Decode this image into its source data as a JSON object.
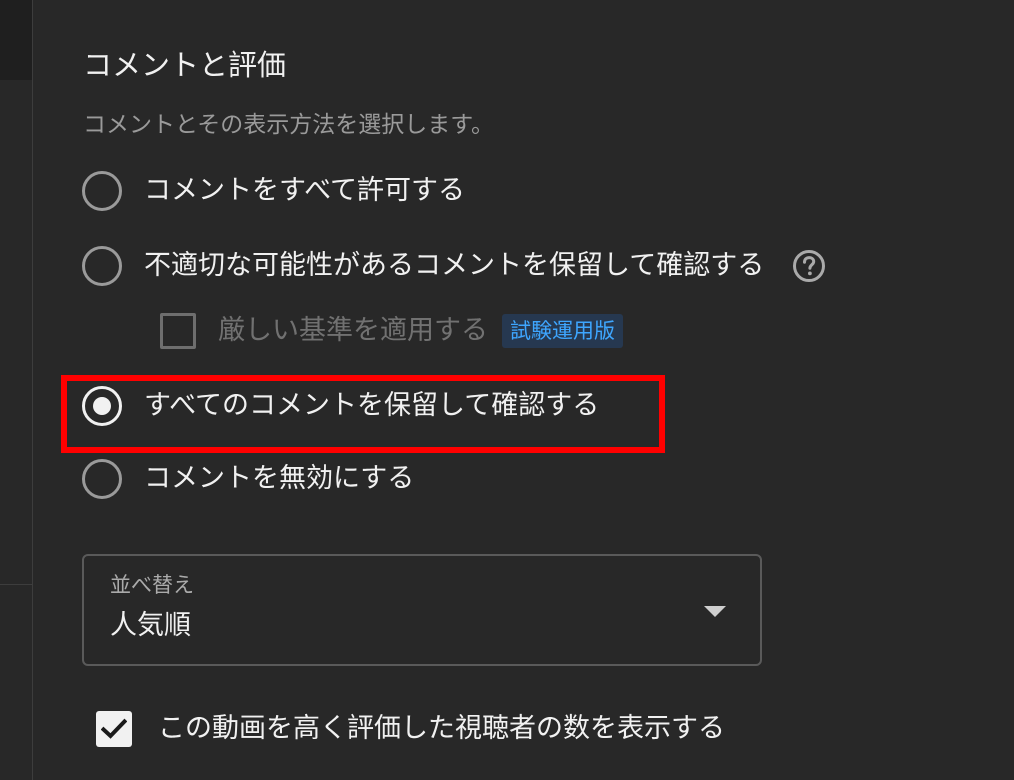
{
  "section": {
    "title": "コメントと評価",
    "description": "コメントとその表示方法を選択します。"
  },
  "comment_options": [
    {
      "label": "コメントをすべて許可する",
      "selected": false
    },
    {
      "label": "不適切な可能性があるコメントを保留して確認する",
      "selected": false,
      "has_help": true
    },
    {
      "label": "すべてのコメントを保留して確認する",
      "selected": true
    },
    {
      "label": "コメントを無効にする",
      "selected": false
    }
  ],
  "strict_filter": {
    "label": "厳しい基準を適用する",
    "badge": "試験運用版",
    "checked": false,
    "disabled": true
  },
  "sort": {
    "caption": "並べ替え",
    "value": "人気順"
  },
  "show_likes": {
    "label": "この動画を高く評価した視聴者の数を表示する",
    "checked": true
  },
  "icons": {
    "help": "help-circle-icon",
    "dropdown": "caret-down-icon",
    "check": "checkmark-icon"
  },
  "colors": {
    "background": "#282828",
    "text": "#f1f1f1",
    "muted": "#9a9a9a",
    "accent_blue": "#3ea6ff",
    "highlight_red": "#ff0000"
  }
}
